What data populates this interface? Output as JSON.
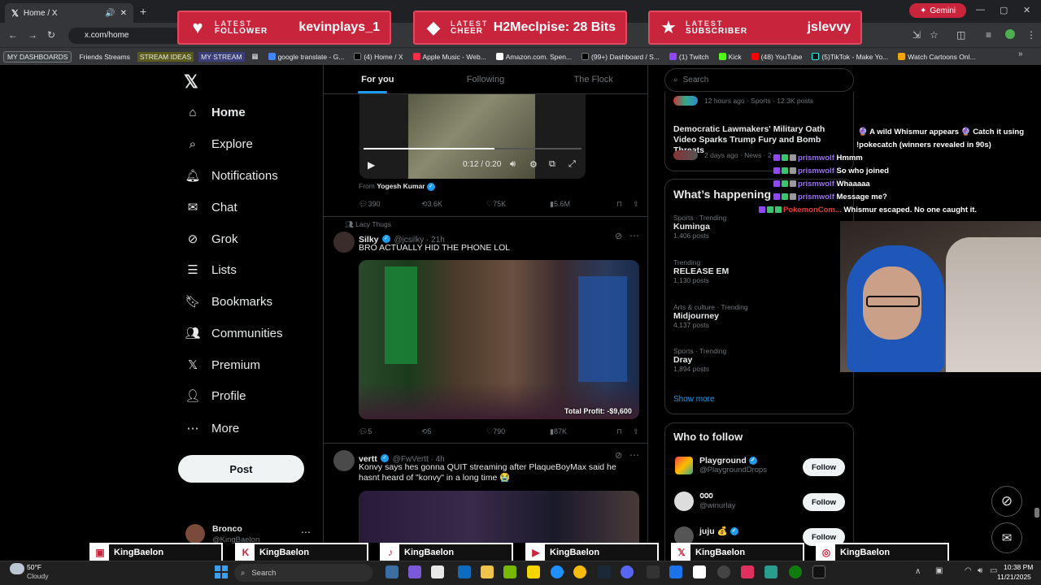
{
  "browser": {
    "tab_title": "Home / X",
    "url": "x.com/home",
    "gemini_label": "Gemini",
    "bookmarks": [
      "MY DASHBOARDS",
      "Friends Streams",
      "STREAM IDEAS",
      "MY STREAM",
      "google translate - G...",
      "(4) Home / X",
      "Apple Music - Web...",
      "Amazon.com. Spen...",
      "(99+) Dashboard / S...",
      "(1) Twitch",
      "Kick",
      "(48) YouTube",
      "(5)TikTok - Make Yo...",
      "Watch Cartoons Onl..."
    ]
  },
  "alerts": {
    "follower": {
      "label_top": "LATEST",
      "label": "FOLLOWER",
      "value": "kevinplays_1"
    },
    "cheer": {
      "label_top": "LATEST",
      "label": "CHEER",
      "value": "H2Meclpise: 28 Bits"
    },
    "subscriber": {
      "label_top": "LATEST",
      "label": "SUBSCRIBER",
      "value": "jslevvy"
    }
  },
  "sidebar": {
    "items": [
      {
        "label": "Home",
        "icon": "home-icon"
      },
      {
        "label": "Explore",
        "icon": "search-icon"
      },
      {
        "label": "Notifications",
        "icon": "bell-icon"
      },
      {
        "label": "Chat",
        "icon": "mail-icon"
      },
      {
        "label": "Grok",
        "icon": "grok-icon"
      },
      {
        "label": "Lists",
        "icon": "list-icon"
      },
      {
        "label": "Bookmarks",
        "icon": "bookmark-icon"
      },
      {
        "label": "Communities",
        "icon": "people-icon"
      },
      {
        "label": "Premium",
        "icon": "x-icon"
      },
      {
        "label": "Profile",
        "icon": "person-icon"
      },
      {
        "label": "More",
        "icon": "more-icon"
      }
    ],
    "post_label": "Post",
    "account_name": "Bronco",
    "account_handle": "@KingBaelon"
  },
  "feed": {
    "tabs": [
      "For you",
      "Following",
      "The Flock"
    ],
    "tweet1": {
      "video_time": "0:12 / 0:20",
      "from_label": "From",
      "from_name": "Yogesh Kumar",
      "replies": "390",
      "reposts": "3.6K",
      "likes": "75K",
      "views": "5.6M"
    },
    "tweet2": {
      "context": "Lacy Thugs",
      "name": "Silky",
      "handle": "@jcsilky · 21h",
      "text": "BRO ACTUALLY HID THE PHONE LOL",
      "overlay_text": "Total Profit: -$9,600",
      "replies": "5",
      "reposts": "5",
      "likes": "790",
      "views": "87K"
    },
    "tweet3": {
      "name": "vertt",
      "handle": "@FwVertt · 4h",
      "text": "Konvy says hes gonna QUIT streaming after PlaqueBoyMax said he hasnt heard of \"konvy\" in a long time 😭"
    }
  },
  "right": {
    "search_placeholder": "Search",
    "top_meta": "12 hours ago · Sports · 12.3K posts",
    "news_title": "Democratic Lawmakers' Military Oath Video Sparks Trump Fury and Bomb Threats",
    "news_meta": "2 days ago · News · 2…",
    "whats_happening": "What’s happening",
    "trends": [
      {
        "meta": "Sports · Trending",
        "name": "Kuminga",
        "posts": "1,406 posts"
      },
      {
        "meta": "Trending",
        "name": "RELEASE EM",
        "posts": "1,130 posts"
      },
      {
        "meta": "Arts & culture · Trending",
        "name": "Midjourney",
        "posts": "4,137 posts"
      },
      {
        "meta": "Sports · Trending",
        "name": "Dray",
        "posts": "1,894 posts"
      }
    ],
    "show_more": "Show more",
    "who_to_follow": "Who to follow",
    "follow_label": "Follow",
    "suggestions": [
      {
        "name": "Playground",
        "handle": "@PlaygroundDrops"
      },
      {
        "name": "൦൦൦",
        "handle": "@winurlay"
      },
      {
        "name": "juju 💰",
        "handle": "@..."
      }
    ]
  },
  "chat": {
    "lines": [
      {
        "user": "",
        "text": "🔮 A wild Whismur appears 🔮 Catch it using"
      },
      {
        "user": "",
        "text": "!pokecatch (winners revealed in 90s)"
      },
      {
        "user": "prismwolf",
        "text": "Hmmm"
      },
      {
        "user": "prismwolf",
        "text": "So who joined"
      },
      {
        "user": "prismwolf",
        "text": "Whaaaaa"
      },
      {
        "user": "prismwolf",
        "text": "Message me?"
      },
      {
        "user": "PokemonCom...",
        "text": "Whismur escaped. No one caught it."
      }
    ]
  },
  "socials": [
    {
      "platform": "twitch",
      "name": "KingBaelon"
    },
    {
      "platform": "kick",
      "name": "KingBaelon"
    },
    {
      "platform": "tiktok",
      "name": "KingBaelon"
    },
    {
      "platform": "youtube",
      "name": "KingBaelon"
    },
    {
      "platform": "x",
      "name": "KingBaelon"
    },
    {
      "platform": "instagram",
      "name": "KingBaelon"
    }
  ],
  "taskbar": {
    "weather_temp": "50°F",
    "weather_desc": "Cloudy",
    "search_label": "Search",
    "time": "10:38 PM",
    "date": "11/21/2025"
  },
  "colors": {
    "accent": "#1d9bf0",
    "alert": "#c8243c",
    "background": "#000000"
  }
}
